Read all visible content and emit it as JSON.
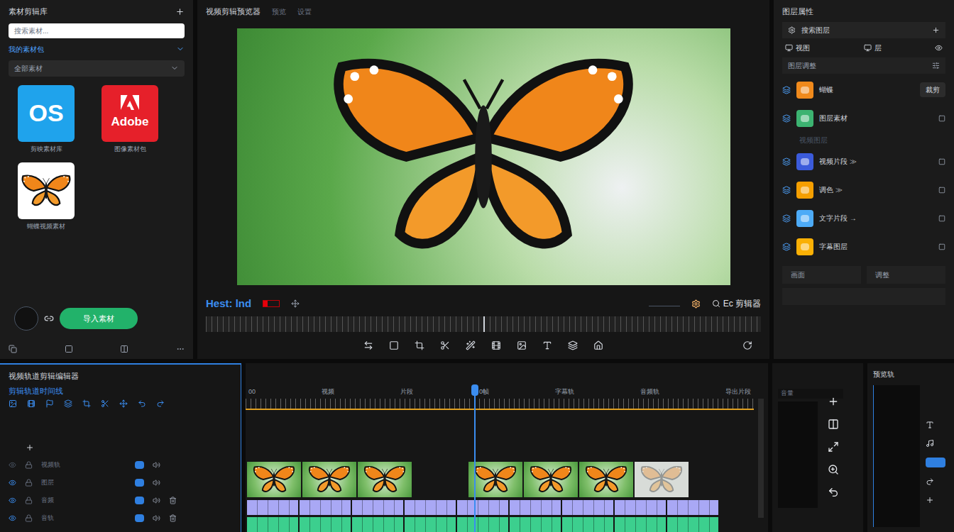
{
  "left_panel": {
    "title": "素材剪辑库",
    "search": {
      "placeholder": "搜索素材..."
    },
    "section": {
      "label": "我的素材包",
      "expanded": true
    },
    "filter": {
      "label": "全部素材"
    },
    "assets": [
      {
        "name": "剪映素材库",
        "logo": "OS",
        "kind": "os"
      },
      {
        "name": "图像素材包",
        "logo": "Adobe",
        "kind": "adobe"
      },
      {
        "name": "蝴蝶视频素材",
        "kind": "butterfly"
      }
    ],
    "import_button": "导入素材"
  },
  "preview": {
    "title": "视频剪辑预览器",
    "tabs": [
      "预览",
      "设置"
    ],
    "timecode": "Hest: lnd",
    "editor_label": "Ec 剪辑器",
    "playhead": 0.5
  },
  "right_panel": {
    "title": "图层属性",
    "search": {
      "placeholder": "搜索图层"
    },
    "toggles": [
      "视图",
      "层"
    ],
    "section": "图层调整",
    "layers": [
      {
        "name": "蝴蝶",
        "badge": "裁剪",
        "color": "#f08a1c"
      },
      {
        "name": "图层素材",
        "color": "#3cb371"
      },
      {
        "name": "视频片段 ≫",
        "color": "#3b5bdb"
      },
      {
        "name": "调色 ≫",
        "color": "#f59f00"
      },
      {
        "name": "文字片段 →",
        "color": "#4dabf7"
      },
      {
        "name": "字幕图层",
        "color": "#fab005"
      }
    ],
    "sublabel": "视频图层",
    "footer": [
      "画面",
      "调整"
    ]
  },
  "timeline": {
    "title": "视频轨道剪辑编辑器",
    "subtitle": "剪辑轨道时间线",
    "ruler_labels": [
      "00",
      "视频",
      "片段",
      "0帧",
      "字幕轨",
      "音频轨",
      "导出片段"
    ],
    "playhead": 0.437,
    "tracks": [
      {
        "name": "视频轨"
      },
      {
        "name": "图层"
      },
      {
        "name": "音频"
      },
      {
        "name": "音轨"
      }
    ],
    "video_clips": [
      {
        "kind": "clip",
        "faded": false
      },
      {
        "kind": "clip",
        "faded": false
      },
      {
        "kind": "clip",
        "faded": false
      },
      {
        "kind": "gap",
        "faded": false
      },
      {
        "kind": "clip",
        "faded": false
      },
      {
        "kind": "clip",
        "faded": false
      },
      {
        "kind": "clip",
        "faded": false
      },
      {
        "kind": "clip",
        "faded": true
      }
    ],
    "audio_tracks": [
      {
        "color": "#a9a8f5",
        "segments": 9
      },
      {
        "color": "#3ccf8e",
        "segments": 9
      }
    ]
  },
  "meter_panel": {
    "title": "音量"
  },
  "far_right_panel": {
    "title": "预览轨"
  }
}
